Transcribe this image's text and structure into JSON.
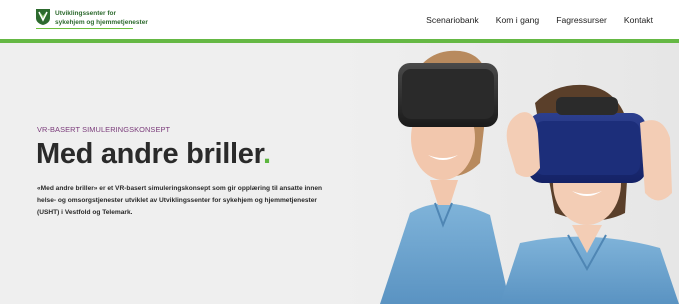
{
  "logo": {
    "line1": "Utviklingssenter for",
    "line2": "sykehjem og hjemmetjenester",
    "icon": "ushth-logo-icon"
  },
  "nav": {
    "items": [
      {
        "label": "Scenariobank"
      },
      {
        "label": "Kom i gang"
      },
      {
        "label": "Fagressurser"
      },
      {
        "label": "Kontakt"
      }
    ]
  },
  "hero": {
    "eyebrow": "VR-BASERT SIMULERINGSKONSEPT",
    "headline": "Med andre briller",
    "headline_dot": ".",
    "body": "«Med andre briller» er et VR-basert simuleringskonsept som gir opplæring til ansatte innen helse- og omsorgstjenester utviklet av Utviklingssenter for sykehjem og hjemmetjenester (USHT) i Vestfold og Telemark."
  },
  "colors": {
    "accent_green": "#65b844",
    "eyebrow_purple": "#7a3b7a",
    "background": "#efefef"
  }
}
